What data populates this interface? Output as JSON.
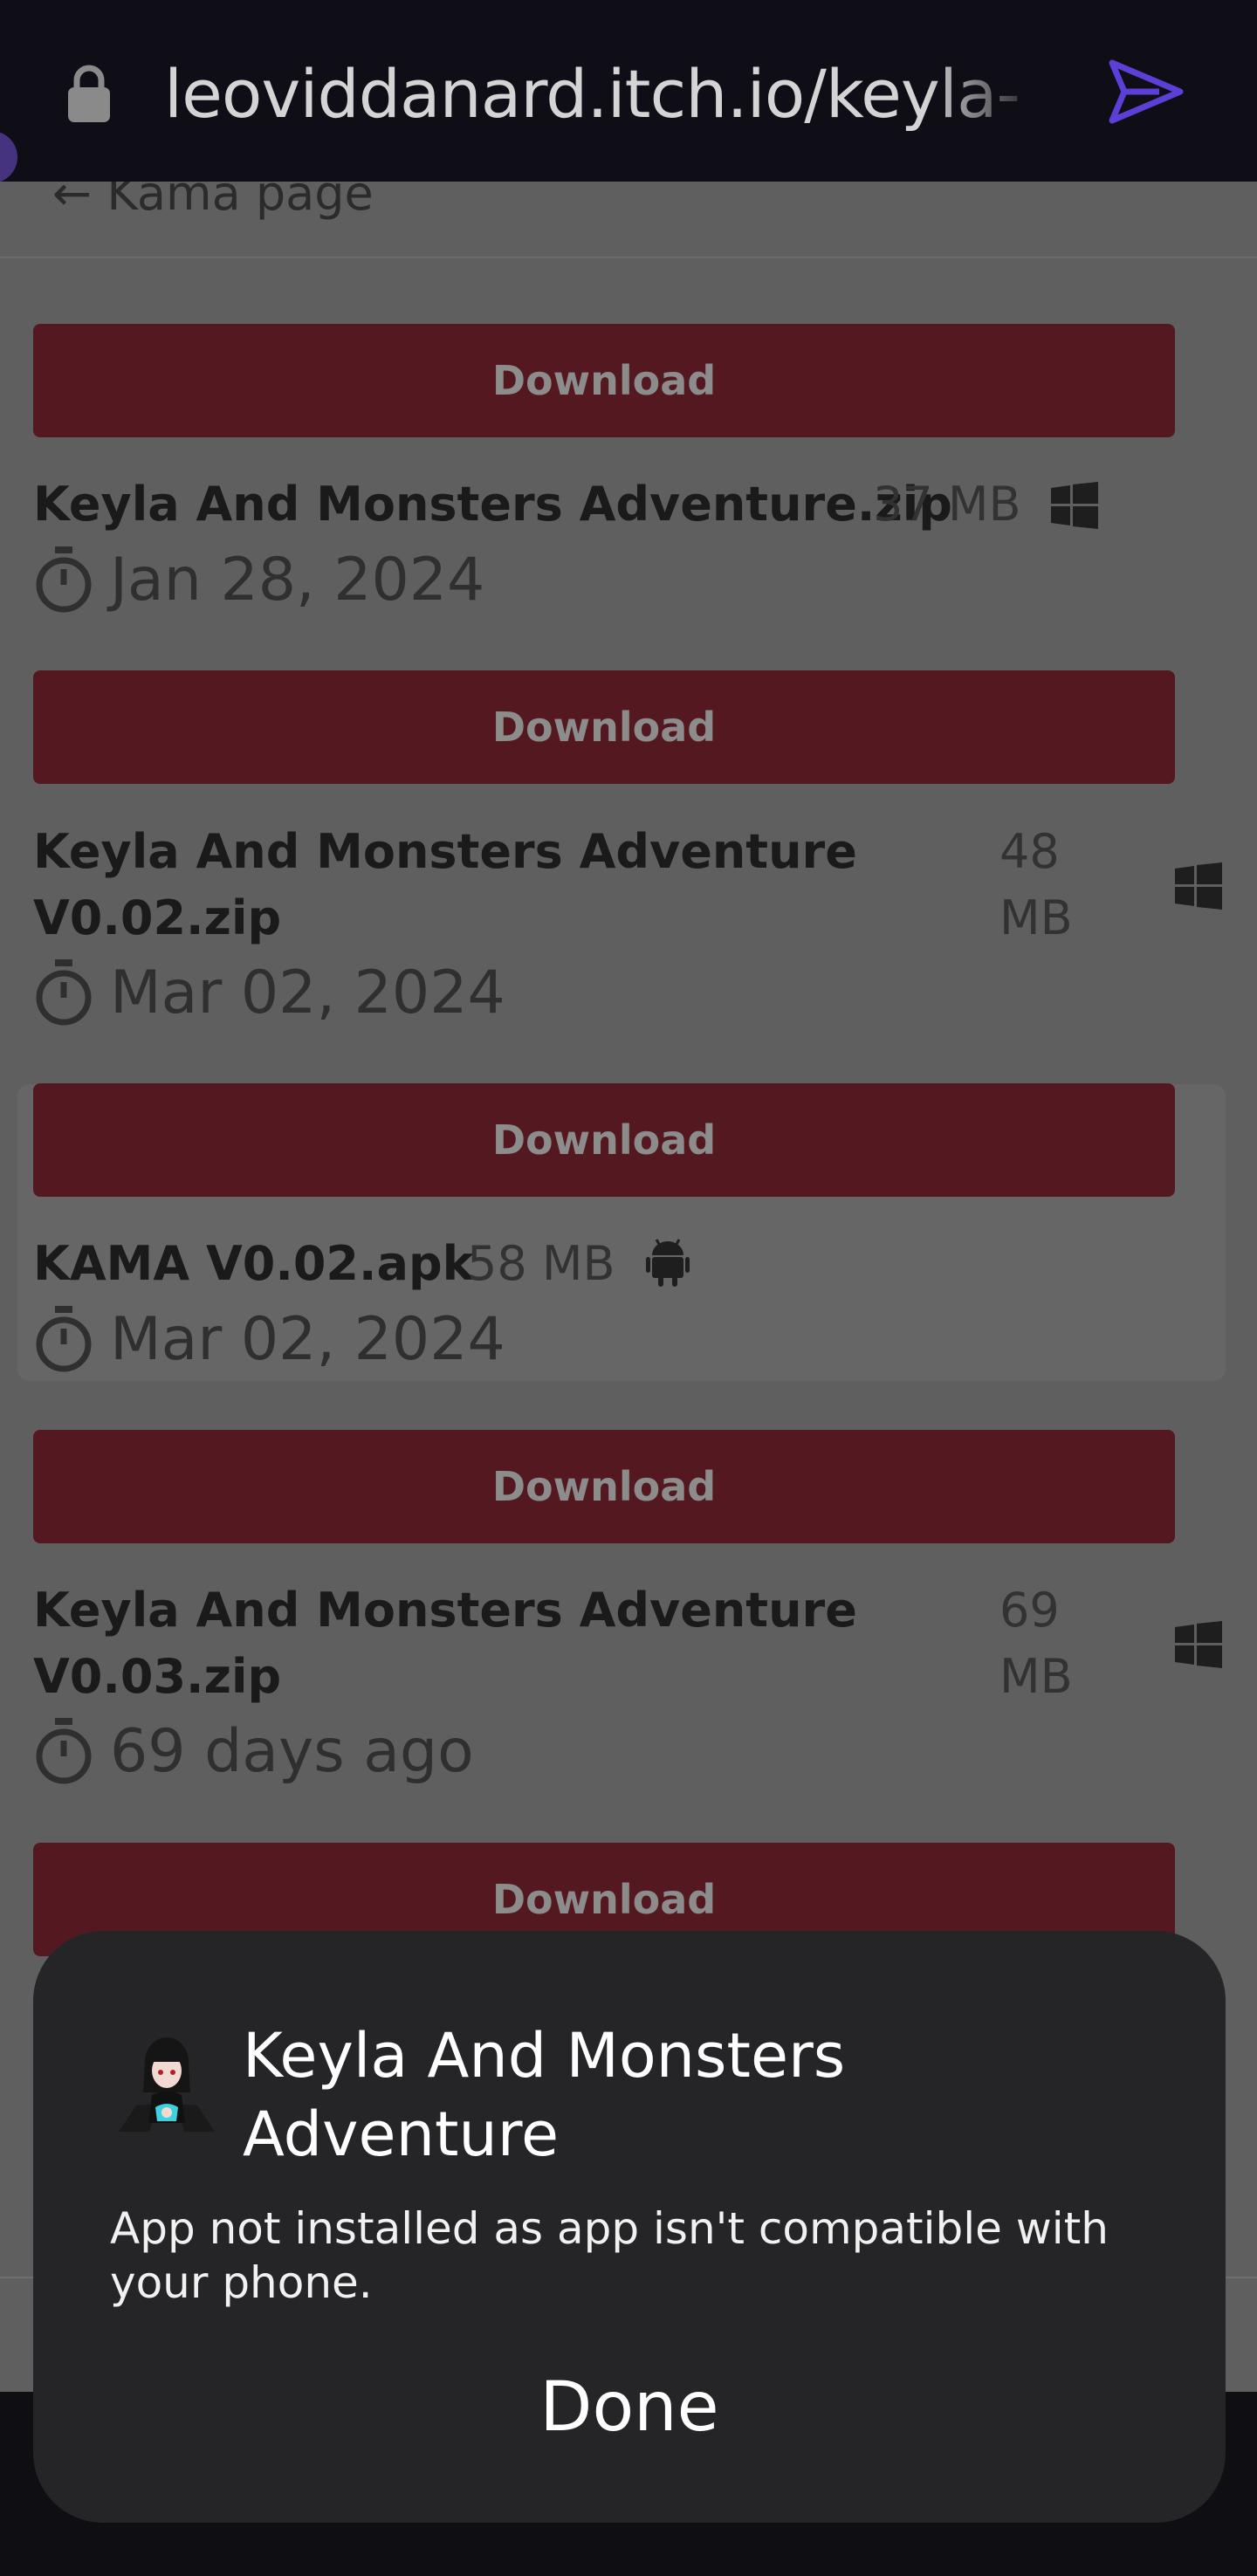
{
  "browser": {
    "url": "leoviddanard.itch.io/keyla-",
    "lock_icon": "lock-icon",
    "send_icon": "send-icon"
  },
  "page": {
    "back_link": "← Kama page"
  },
  "downloads": [
    {
      "button": "Download",
      "name": "Keyla And Monsters Adventure.zip",
      "size": "37 MB",
      "platform": "windows-icon",
      "date": "Jan 28, 2024"
    },
    {
      "button": "Download",
      "name": "Keyla And Monsters Adventure V0.02.zip",
      "size": "48 MB",
      "platform": "windows-icon",
      "date": "Mar 02, 2024"
    },
    {
      "button": "Download",
      "name": "KAMA V0.02.apk",
      "size": "58 MB",
      "platform": "android-icon",
      "date": "Mar 02, 2024"
    },
    {
      "button": "Download",
      "name": "Keyla And Monsters Adventure V0.03.zip",
      "size": "69 MB",
      "platform": "windows-icon",
      "date": "69 days ago"
    },
    {
      "button": "Download"
    }
  ],
  "dialog": {
    "title": "Keyla And Monsters Adventure",
    "message": "App not installed as app isn't compatible with your phone.",
    "done": "Done"
  },
  "colors": {
    "download_button": "#541820",
    "dialog_bg": "#252528",
    "overlay_page": "#5f5f5f",
    "url_bar": "#0f0e16",
    "send_accent": "#5c3fd6"
  }
}
